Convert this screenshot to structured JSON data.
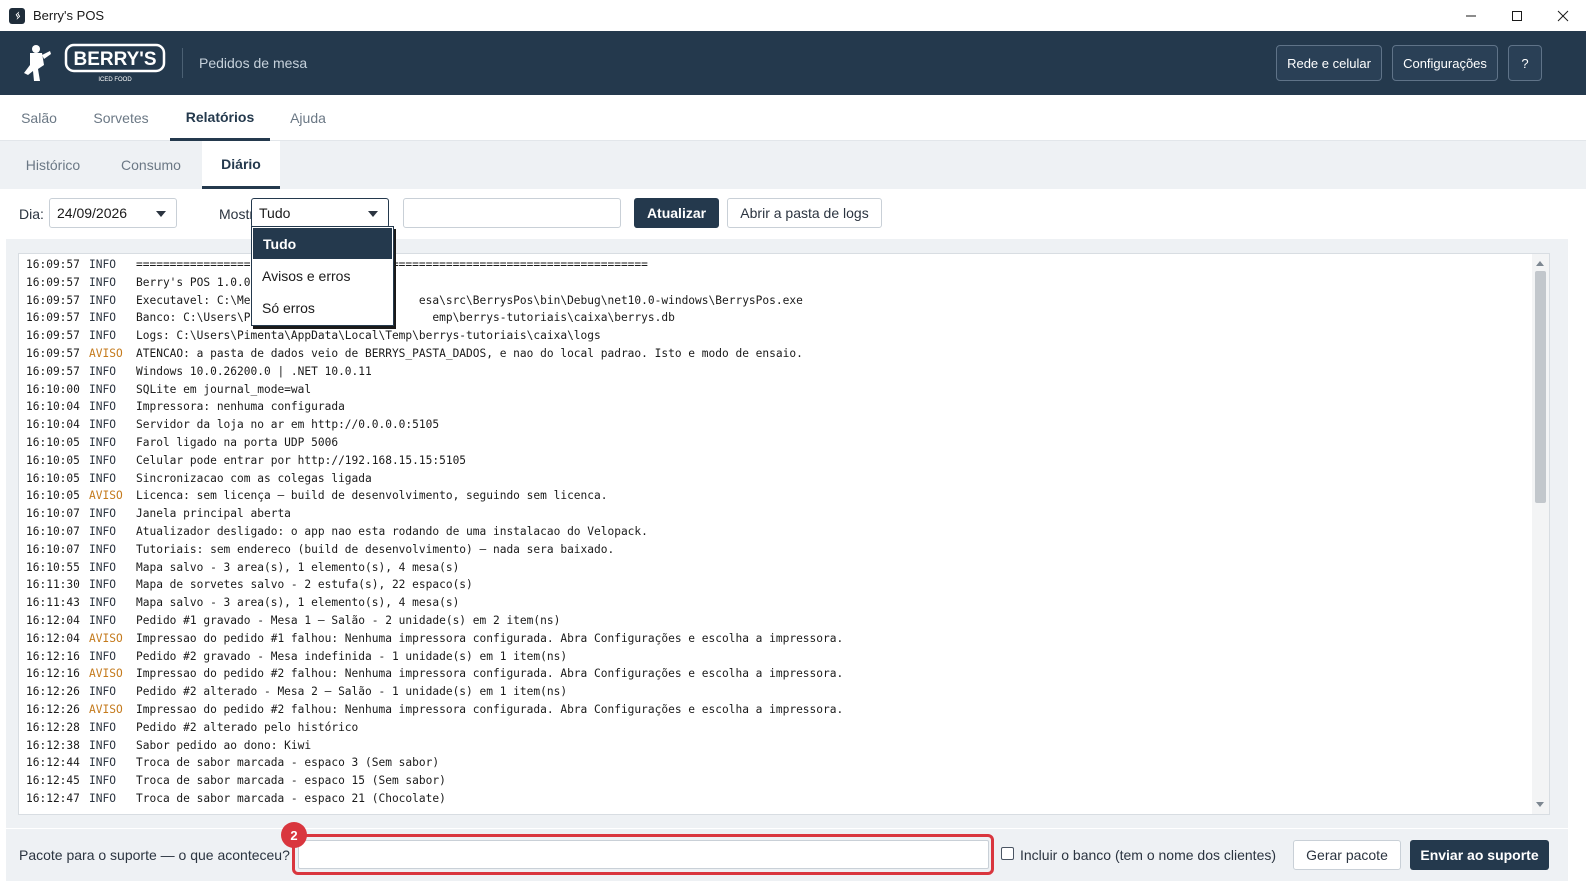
{
  "window": {
    "title": "Berry's POS"
  },
  "header": {
    "logo_text": "BERRY'S",
    "logo_sub": "ICED FOOD",
    "subtitle": "Pedidos de mesa",
    "buttons": {
      "network": "Rede e celular",
      "settings": "Configurações",
      "help": "?"
    }
  },
  "main_tabs": [
    {
      "label": "Salão"
    },
    {
      "label": "Sorvetes"
    },
    {
      "label": "Relatórios",
      "active": true
    },
    {
      "label": "Ajuda"
    }
  ],
  "sub_tabs": [
    {
      "label": "Histórico"
    },
    {
      "label": "Consumo"
    },
    {
      "label": "Diário",
      "active": true
    }
  ],
  "toolbar": {
    "day_label": "Dia:",
    "day_value": "24/09/2026",
    "show_label": "Mostrar:",
    "show_value": "Tudo",
    "filter_value": "",
    "refresh_label": "Atualizar",
    "open_logs_label": "Abrir a pasta de logs"
  },
  "dropdown": {
    "options": [
      "Tudo",
      "Avisos e erros",
      "Só erros"
    ],
    "selected": "Tudo"
  },
  "log": [
    {
      "time": "16:09:57",
      "level": "INFO",
      "msg": "============================================================================"
    },
    {
      "time": "16:09:57",
      "level": "INFO",
      "msg": "Berry's POS 1.0.0.0"
    },
    {
      "time": "16:09:57",
      "level": "INFO",
      "msg": "Executavel: C:\\Meu                        esa\\src\\BerrysPos\\bin\\Debug\\net10.0-windows\\BerrysPos.exe"
    },
    {
      "time": "16:09:57",
      "level": "INFO",
      "msg": "Banco: C:\\Users\\Pi                          emp\\berrys-tutoriais\\caixa\\berrys.db"
    },
    {
      "time": "16:09:57",
      "level": "INFO",
      "msg": "Logs: C:\\Users\\Pimenta\\AppData\\Local\\Temp\\berrys-tutoriais\\caixa\\logs"
    },
    {
      "time": "16:09:57",
      "level": "AVISO",
      "msg": "ATENCAO: a pasta de dados veio de BERRYS_PASTA_DADOS, e nao do local padrao. Isto e modo de ensaio."
    },
    {
      "time": "16:09:57",
      "level": "INFO",
      "msg": "Windows 10.0.26200.0 | .NET 10.0.11"
    },
    {
      "time": "16:10:00",
      "level": "INFO",
      "msg": "SQLite em journal_mode=wal"
    },
    {
      "time": "16:10:04",
      "level": "INFO",
      "msg": "Impressora: nenhuma configurada"
    },
    {
      "time": "16:10:04",
      "level": "INFO",
      "msg": "Servidor da loja no ar em http://0.0.0.0:5105"
    },
    {
      "time": "16:10:05",
      "level": "INFO",
      "msg": "Farol ligado na porta UDP 5006"
    },
    {
      "time": "16:10:05",
      "level": "INFO",
      "msg": "Celular pode entrar por http://192.168.15.15:5105"
    },
    {
      "time": "16:10:05",
      "level": "INFO",
      "msg": "Sincronizacao com as colegas ligada"
    },
    {
      "time": "16:10:05",
      "level": "AVISO",
      "msg": "Licenca: sem licença — build de desenvolvimento, seguindo sem licenca."
    },
    {
      "time": "16:10:07",
      "level": "INFO",
      "msg": "Janela principal aberta"
    },
    {
      "time": "16:10:07",
      "level": "INFO",
      "msg": "Atualizador desligado: o app nao esta rodando de uma instalacao do Velopack."
    },
    {
      "time": "16:10:07",
      "level": "INFO",
      "msg": "Tutoriais: sem endereco (build de desenvolvimento) — nada sera baixado."
    },
    {
      "time": "16:10:55",
      "level": "INFO",
      "msg": "Mapa salvo - 3 area(s), 1 elemento(s), 4 mesa(s)"
    },
    {
      "time": "16:11:30",
      "level": "INFO",
      "msg": "Mapa de sorvetes salvo - 2 estufa(s), 22 espaco(s)"
    },
    {
      "time": "16:11:43",
      "level": "INFO",
      "msg": "Mapa salvo - 3 area(s), 1 elemento(s), 4 mesa(s)"
    },
    {
      "time": "16:12:04",
      "level": "INFO",
      "msg": "Pedido #1 gravado - Mesa 1 — Salão - 2 unidade(s) em 2 item(ns)"
    },
    {
      "time": "16:12:04",
      "level": "AVISO",
      "msg": "Impressao do pedido #1 falhou: Nenhuma impressora configurada. Abra Configurações e escolha a impressora."
    },
    {
      "time": "16:12:16",
      "level": "INFO",
      "msg": "Pedido #2 gravado - Mesa indefinida - 1 unidade(s) em 1 item(ns)"
    },
    {
      "time": "16:12:16",
      "level": "AVISO",
      "msg": "Impressao do pedido #2 falhou: Nenhuma impressora configurada. Abra Configurações e escolha a impressora."
    },
    {
      "time": "16:12:26",
      "level": "INFO",
      "msg": "Pedido #2 alterado - Mesa 2 — Salão - 1 unidade(s) em 1 item(ns)"
    },
    {
      "time": "16:12:26",
      "level": "AVISO",
      "msg": "Impressao do pedido #2 falhou: Nenhuma impressora configurada. Abra Configurações e escolha a impressora."
    },
    {
      "time": "16:12:28",
      "level": "INFO",
      "msg": "Pedido #2 alterado pelo histórico"
    },
    {
      "time": "16:12:38",
      "level": "INFO",
      "msg": "Sabor pedido ao dono: Kiwi"
    },
    {
      "time": "16:12:44",
      "level": "INFO",
      "msg": "Troca de sabor marcada - espaco 3 (Sem sabor)"
    },
    {
      "time": "16:12:45",
      "level": "INFO",
      "msg": "Troca de sabor marcada - espaco 15 (Sem sabor)"
    },
    {
      "time": "16:12:47",
      "level": "INFO",
      "msg": "Troca de sabor marcada - espaco 21 (Chocolate)"
    }
  ],
  "bottom": {
    "question_label": "Pacote para o suporte — o que aconteceu?",
    "input_value": "",
    "badge": "2",
    "include_db_label": "Incluir o banco (tem o nome dos clientes)",
    "include_db_checked": false,
    "generate_label": "Gerar pacote",
    "send_label": "Enviar ao suporte"
  },
  "colors": {
    "primary": "#24394d",
    "warning": "#c47a1c",
    "highlight": "#d9363e"
  }
}
